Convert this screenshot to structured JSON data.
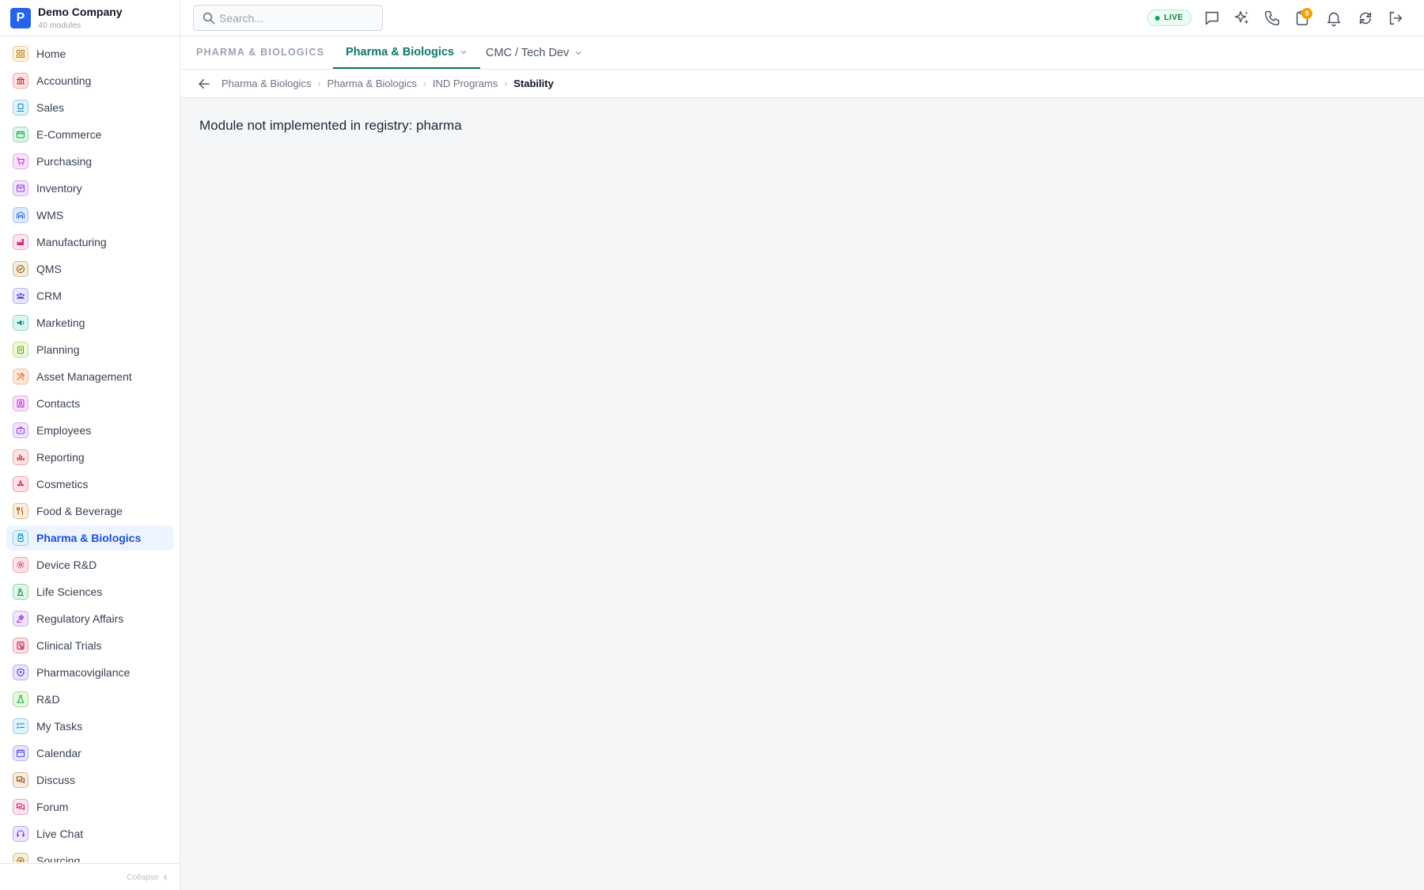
{
  "brand": {
    "logo_letter": "P",
    "name": "Demo Company",
    "subtitle": "40 modules"
  },
  "sidebar": {
    "items": [
      {
        "label": "Home",
        "icon": "grid-icon",
        "fg": "#b7791f",
        "bg": "#fdf3d8"
      },
      {
        "label": "Accounting",
        "icon": "bank-icon",
        "fg": "#dc2626",
        "bg": "#fde4e4"
      },
      {
        "label": "Sales",
        "icon": "badge-icon",
        "fg": "#0284c7",
        "bg": "#dff3fc"
      },
      {
        "label": "E-Commerce",
        "icon": "store-icon",
        "fg": "#16a34a",
        "bg": "#dcf7e5"
      },
      {
        "label": "Purchasing",
        "icon": "cart-icon",
        "fg": "#c026d3",
        "bg": "#f8e3fb"
      },
      {
        "label": "Inventory",
        "icon": "box-icon",
        "fg": "#9333ea",
        "bg": "#f0e5fd"
      },
      {
        "label": "WMS",
        "icon": "warehouse-icon",
        "fg": "#2563eb",
        "bg": "#e2ebfd"
      },
      {
        "label": "Manufacturing",
        "icon": "factory-icon",
        "fg": "#db2777",
        "bg": "#fce4f0"
      },
      {
        "label": "QMS",
        "icon": "check-circle-icon",
        "fg": "#854d0e",
        "bg": "#f6ecd9"
      },
      {
        "label": "CRM",
        "icon": "users-icon",
        "fg": "#4f46e5",
        "bg": "#e7e6fd"
      },
      {
        "label": "Marketing",
        "icon": "megaphone-icon",
        "fg": "#0d9488",
        "bg": "#dbf5f1"
      },
      {
        "label": "Planning",
        "icon": "clipboard-icon",
        "fg": "#65a30d",
        "bg": "#edf7d9"
      },
      {
        "label": "Asset Management",
        "icon": "tools-icon",
        "fg": "#ea580c",
        "bg": "#fde9da"
      },
      {
        "label": "Contacts",
        "icon": "contact-icon",
        "fg": "#c026d3",
        "bg": "#f8e3fb"
      },
      {
        "label": "Employees",
        "icon": "employee-icon",
        "fg": "#9333ea",
        "bg": "#f0e5fd"
      },
      {
        "label": "Reporting",
        "icon": "bar-chart-icon",
        "fg": "#dc2626",
        "bg": "#fde4e4"
      },
      {
        "label": "Cosmetics",
        "icon": "flower-icon",
        "fg": "#e11d48",
        "bg": "#fde3e8"
      },
      {
        "label": "Food & Beverage",
        "icon": "utensils-icon",
        "fg": "#b45309",
        "bg": "#fbeedb"
      },
      {
        "label": "Pharma & Biologics",
        "icon": "pill-bottle-icon",
        "fg": "#0284c7",
        "bg": "#dff3fc",
        "active": true
      },
      {
        "label": "Device R&D",
        "icon": "cog-icon",
        "fg": "#e11d48",
        "bg": "#fde3e8"
      },
      {
        "label": "Life Sciences",
        "icon": "microscope-icon",
        "fg": "#15803d",
        "bg": "#dcf7e5"
      },
      {
        "label": "Regulatory Affairs",
        "icon": "gavel-icon",
        "fg": "#9333ea",
        "bg": "#f0e5fd"
      },
      {
        "label": "Clinical Trials",
        "icon": "clinical-icon",
        "fg": "#be123c",
        "bg": "#fde3e8"
      },
      {
        "label": "Pharmacovigilance",
        "icon": "shield-icon",
        "fg": "#4338ca",
        "bg": "#e7e6fd"
      },
      {
        "label": "R&D",
        "icon": "flask-icon",
        "fg": "#16a34a",
        "bg": "#e6f8da"
      },
      {
        "label": "My Tasks",
        "icon": "checklist-icon",
        "fg": "#0284c7",
        "bg": "#dff3fc"
      },
      {
        "label": "Calendar",
        "icon": "calendar-icon",
        "fg": "#4f46e5",
        "bg": "#e7e6fd"
      },
      {
        "label": "Discuss",
        "icon": "chat-icon",
        "fg": "#92400e",
        "bg": "#f6ecd9"
      },
      {
        "label": "Forum",
        "icon": "forum-icon",
        "fg": "#be185d",
        "bg": "#fce4f0"
      },
      {
        "label": "Live Chat",
        "icon": "headset-icon",
        "fg": "#6d28d9",
        "bg": "#ece6fd"
      },
      {
        "label": "Sourcing",
        "icon": "sourcing-icon",
        "fg": "#a16207",
        "bg": "#f7efd5"
      }
    ],
    "collapse_label": "Collapse"
  },
  "topbar": {
    "search_placeholder": "Search...",
    "live_label": "LIVE",
    "notification_badge": "9",
    "icons": [
      "message-icon",
      "sparkle-icon",
      "phone-icon",
      "clipboard-alert-icon",
      "bell-icon",
      "sync-icon",
      "logout-icon"
    ]
  },
  "tabs": {
    "section_label": "PHARMA & BIOLOGICS",
    "items": [
      {
        "label": "Pharma & Biologics",
        "active": true
      },
      {
        "label": "CMC / Tech Dev",
        "active": false
      }
    ]
  },
  "breadcrumb": {
    "items": [
      "Pharma & Biologics",
      "Pharma & Biologics",
      "IND Programs"
    ],
    "current": "Stability"
  },
  "main": {
    "message": "Module not implemented in registry: pharma"
  },
  "colors": {
    "brand": "#2563eb",
    "accent": "#0f766e",
    "active_nav": "#1d4ed8",
    "live": "#16a34a"
  }
}
